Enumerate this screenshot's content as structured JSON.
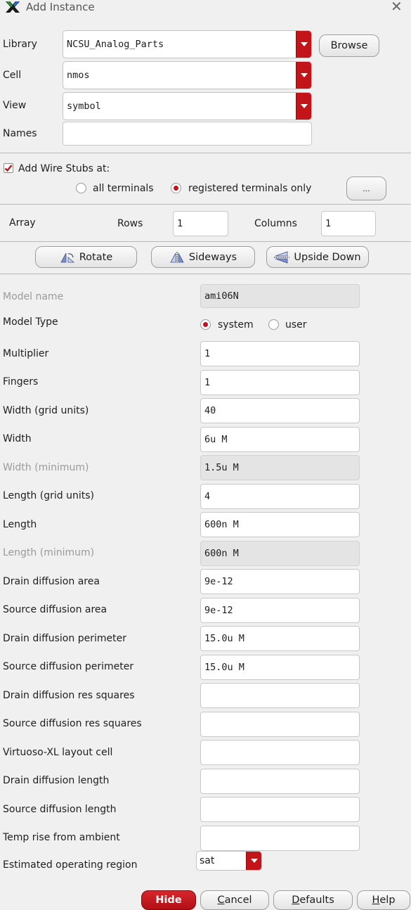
{
  "window": {
    "title": "Add Instance",
    "close_glyph": "✕"
  },
  "top": {
    "library_label": "Library",
    "library_value": "NCSU_Analog_Parts",
    "browse_label": "Browse",
    "cell_label": "Cell",
    "cell_value": "nmos",
    "view_label": "View",
    "view_value": "symbol",
    "names_label": "Names",
    "names_value": ""
  },
  "stubs": {
    "checkbox_label": "Add Wire Stubs at:",
    "checked": true,
    "option_all": "all terminals",
    "option_registered": "registered terminals only",
    "selected": "registered terminals only",
    "more_label": "..."
  },
  "array": {
    "label": "Array",
    "rows_label": "Rows",
    "rows_value": "1",
    "columns_label": "Columns",
    "columns_value": "1"
  },
  "transform": {
    "rotate": "Rotate",
    "sideways": "Sideways",
    "upside_down": "Upside Down"
  },
  "params": {
    "model_name_label": "Model name",
    "model_name_value": "ami06N",
    "model_type_label": "Model Type",
    "model_type_system": "system",
    "model_type_user": "user",
    "model_type_selected": "system",
    "multiplier_label": "Multiplier",
    "multiplier_value": "1",
    "fingers_label": "Fingers",
    "fingers_value": "1",
    "width_grid_label": "Width (grid units)",
    "width_grid_value": "40",
    "width_label": "Width",
    "width_value": "6u M",
    "width_min_label": "Width (minimum)",
    "width_min_value": "1.5u M",
    "length_grid_label": "Length (grid units)",
    "length_grid_value": "4",
    "length_label": "Length",
    "length_value": "600n M",
    "length_min_label": "Length (minimum)",
    "length_min_value": "600n M",
    "drain_area_label": "Drain diffusion area",
    "drain_area_value": "9e-12",
    "source_area_label": "Source diffusion area",
    "source_area_value": "9e-12",
    "drain_perim_label": "Drain diffusion perimeter",
    "drain_perim_value": "15.0u M",
    "source_perim_label": "Source diffusion perimeter",
    "source_perim_value": "15.0u M",
    "drain_sq_label": "Drain diffusion res squares",
    "drain_sq_value": "",
    "source_sq_label": "Source diffusion res squares",
    "source_sq_value": "",
    "vxl_label": "Virtuoso-XL layout cell",
    "vxl_value": "",
    "drain_len_label": "Drain diffusion length",
    "drain_len_value": "",
    "source_len_label": "Source diffusion length",
    "source_len_value": "",
    "temp_label": "Temp rise from ambient",
    "temp_value": "",
    "region_label": "Estimated operating region",
    "region_value": "sat"
  },
  "footer": {
    "hide": "Hide",
    "cancel_first": "C",
    "cancel_rest": "ancel",
    "defaults_first": "D",
    "defaults_rest": "efaults",
    "help_first": "H",
    "help_rest": "elp"
  },
  "colors": {
    "accent_red": "#c3141a",
    "window_bg": "#f0f0f0"
  },
  "icons": [
    "x-app-icon",
    "close-icon",
    "chevron-down-icon",
    "rotate-icon",
    "sideways-icon",
    "upside-down-icon",
    "radio-icon",
    "checkbox-icon"
  ]
}
